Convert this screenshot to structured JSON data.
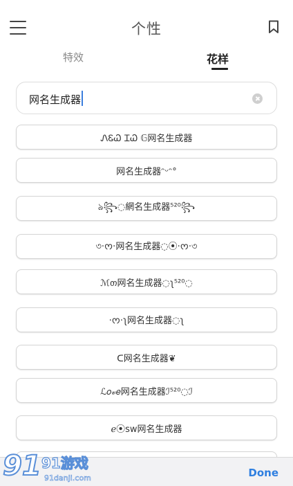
{
  "header": {
    "title": "个性"
  },
  "tabs": [
    {
      "label": "特效",
      "active": false
    },
    {
      "label": "花样",
      "active": true
    }
  ],
  "search": {
    "value": "网名生成器",
    "placeholder": ""
  },
  "results": [
    "ᏁᏋᏇ ᏆᏇ 𝔾网名生成器",
    "网名生成器ᵔᵕᵔ°",
    "ঌ꧂◌網名生成器⁵²⁰꧂",
    "৩·ᰔ·网名生成器◌⦿·ᰔ·৩",
    "ℳთ网名生成器◌ʅ⁵²⁰◌",
    "·ᰔ·ʅ网名生成器◌ʅ",
    "ᑕ网名生成器❦",
    "ℒ𝑜𝓋𝑒网名生成器ℐ⁵²⁰◌ℐ",
    "ℯ⦿sw网名生成器"
  ],
  "bottom": {
    "done_label": "Done"
  },
  "watermark": {
    "brand": "91游戏",
    "site": "91danji.com"
  },
  "icons": {
    "menu": "menu-icon",
    "bookmark": "bookmark-icon",
    "clear": "clear-icon"
  },
  "colors": {
    "accent": "#2f7fe0",
    "text": "#333333",
    "border": "#d4d4d4"
  }
}
